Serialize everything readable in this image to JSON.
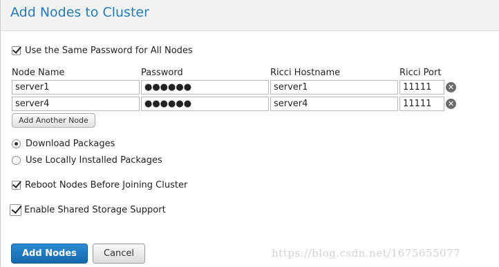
{
  "dialog": {
    "title": "Add Nodes to Cluster"
  },
  "options": {
    "same_password_label": "Use the Same Password for All Nodes",
    "same_password_checked": true,
    "download_packages_label": "Download Packages",
    "download_packages_selected": true,
    "local_packages_label": "Use Locally Installed Packages",
    "local_packages_selected": false,
    "reboot_label": "Reboot Nodes Before Joining Cluster",
    "reboot_checked": true,
    "shared_storage_label": "Enable Shared Storage Support",
    "shared_storage_checked": true
  },
  "nodes_table": {
    "headers": [
      "Node Name",
      "Password",
      "Ricci Hostname",
      "Ricci Port"
    ],
    "rows": [
      {
        "node_name": "server1",
        "password": "●●●●●●",
        "ricci_hostname": "server1",
        "ricci_port": "11111"
      },
      {
        "node_name": "server4",
        "password": "●●●●●●",
        "ricci_hostname": "server4",
        "ricci_port": "11111"
      }
    ]
  },
  "buttons": {
    "add_another_node": "Add Another Node",
    "add_nodes": "Add Nodes",
    "cancel": "Cancel"
  },
  "watermark": "https://blog.csdn.net/1675655077",
  "colors": {
    "title": "#1f7cbf",
    "primary_button": "#1a72b8"
  }
}
